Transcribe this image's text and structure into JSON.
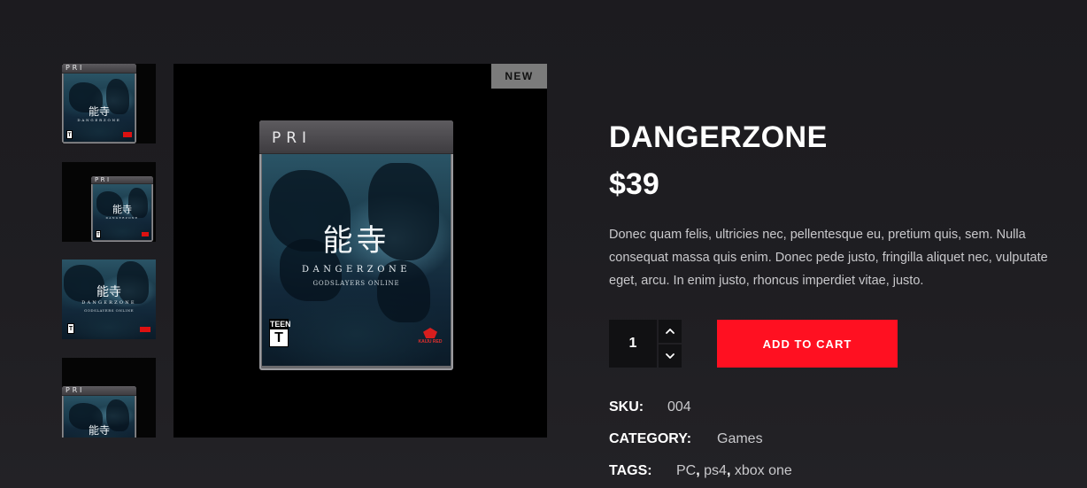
{
  "product": {
    "badge": "NEW",
    "title": "DANGERZONE",
    "price": "$39",
    "description": "Donec quam felis, ultricies nec, pellentesque eu, pretium quis, sem. Nulla consequat massa quis enim. Donec pede justo, fringilla aliquet nec, vulputate eget, arcu. In enim justo, rhoncus imperdiet vitae, justo.",
    "quantity": "1",
    "add_to_cart_label": "ADD TO CART",
    "sku_label": "SKU:",
    "sku": "004",
    "category_label": "CATEGORY:",
    "category": "Games",
    "tags_label": "TAGS:",
    "tags": [
      "PC",
      "ps4",
      "xbox one"
    ]
  },
  "cover_art": {
    "platform_mark": "PRI",
    "kanji": "能寺",
    "game_title": "DANGERZONE",
    "game_subtitle": "GODSLAYERS ONLINE",
    "rating": "T",
    "rating_band": "TEEN",
    "publisher": "KAIJU RED"
  },
  "icons": {
    "qty_up": "chevron-up-icon",
    "qty_down": "chevron-down-icon"
  },
  "colors": {
    "accent": "#ff1021",
    "badge_bg": "#7b7b7b",
    "background": "#1e1d21"
  }
}
